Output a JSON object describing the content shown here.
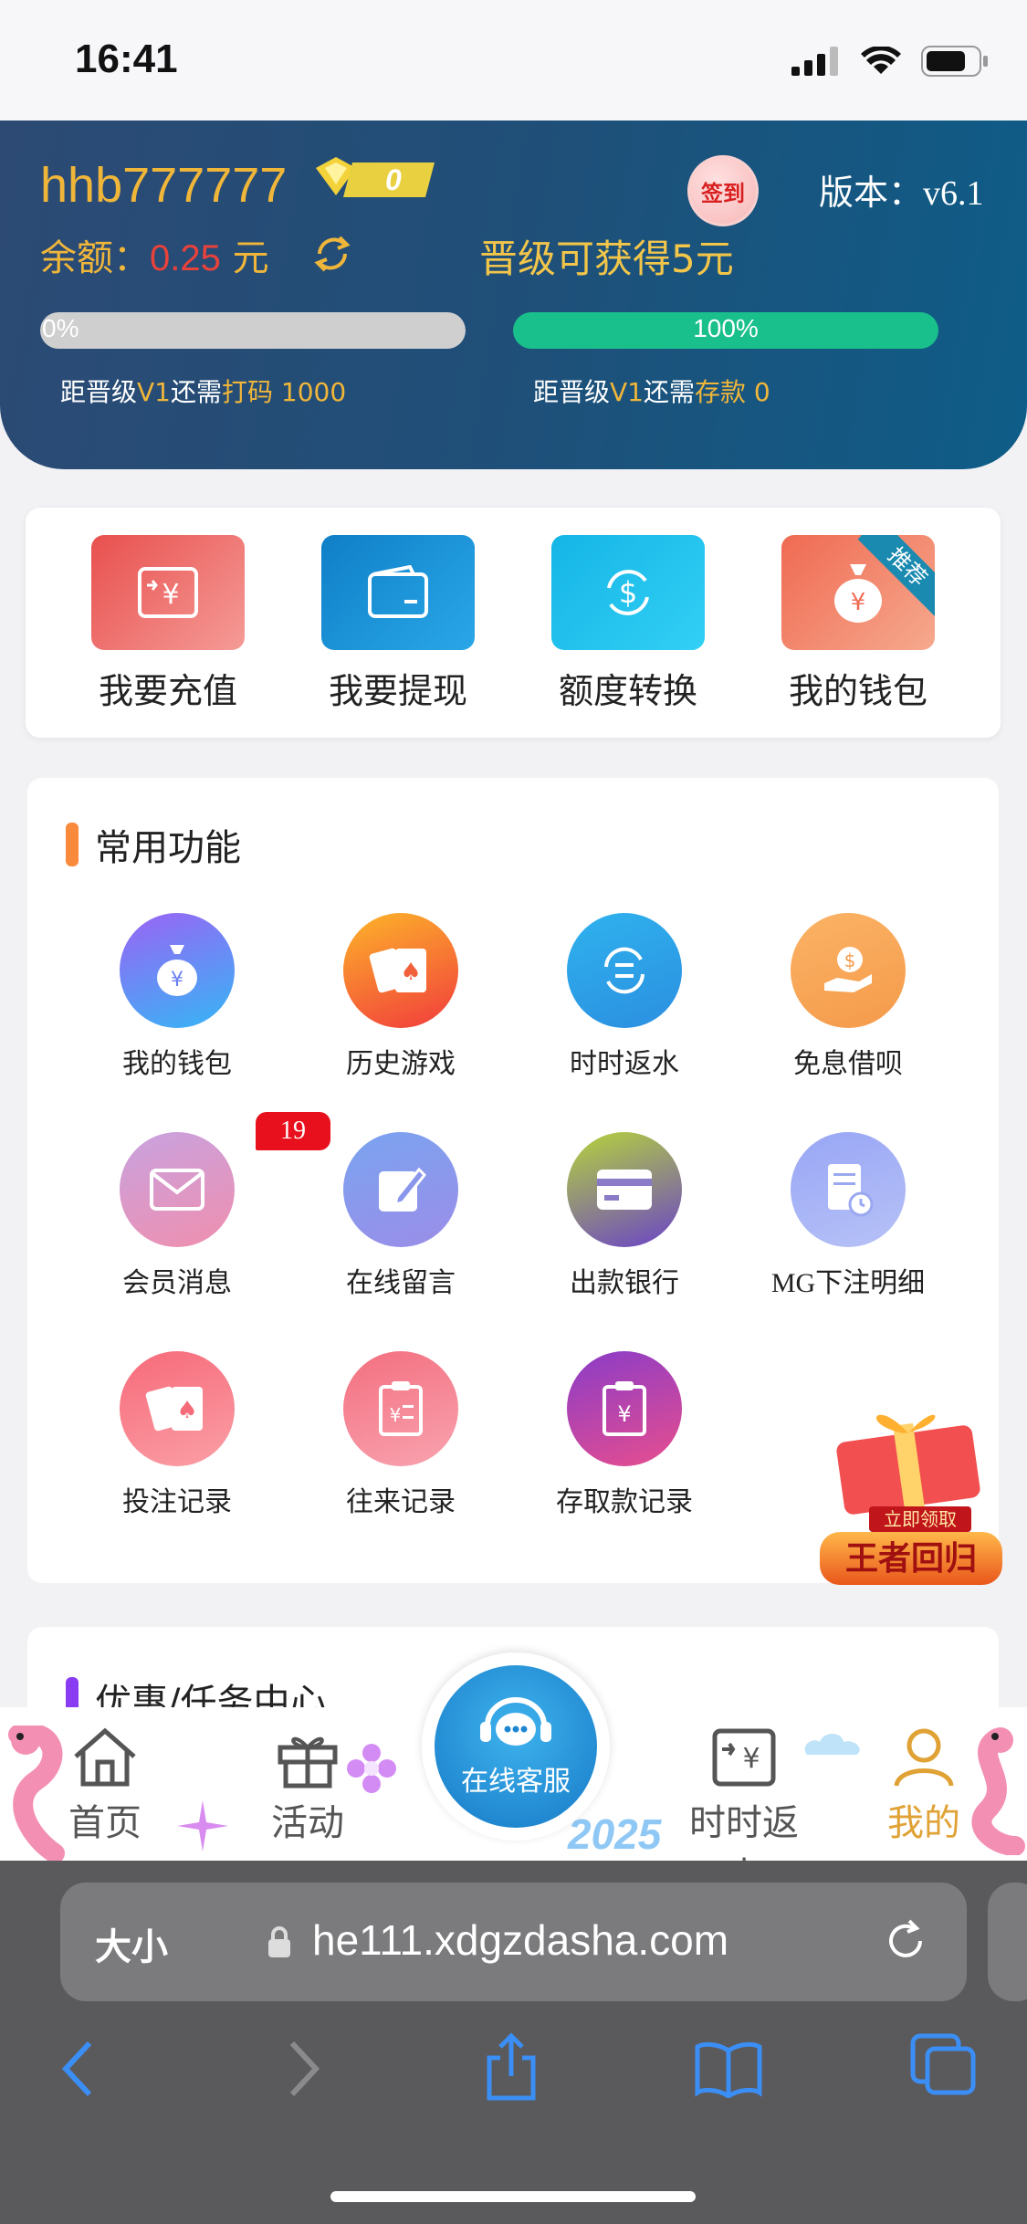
{
  "status_bar": {
    "time": "16:41"
  },
  "header": {
    "username": "hhb777777",
    "vip_level": "0",
    "checkin_label": "签到",
    "version": "版本：v6.1",
    "balance_label": "余额：",
    "balance_value": "0.25",
    "balance_unit": "元",
    "promo_text": "晋级可获得5元",
    "progress_left": {
      "percent_text": "0%",
      "fraction": 0,
      "prefix": "距晋级",
      "level": "V1",
      "mid": "还需",
      "requirement": "打码 1000"
    },
    "progress_right": {
      "percent_text": "100%",
      "fraction": 1,
      "prefix": "距晋级",
      "level": "V1",
      "mid": "还需",
      "requirement": "存款 0"
    }
  },
  "quick_actions": [
    {
      "label": "我要充值",
      "icon": "recharge-icon"
    },
    {
      "label": "我要提现",
      "icon": "wallet-card-icon"
    },
    {
      "label": "额度转换",
      "icon": "dollar-exchange-icon"
    },
    {
      "label": "我的钱包",
      "icon": "money-bag-icon",
      "ribbon": "推荐"
    }
  ],
  "common_functions": {
    "title": "常用功能",
    "items": [
      {
        "label": "我的钱包",
        "icon": "money-bag-icon"
      },
      {
        "label": "历史游戏",
        "icon": "playing-cards-icon"
      },
      {
        "label": "时时返水",
        "icon": "refresh-rebate-icon"
      },
      {
        "label": "免息借呗",
        "icon": "hand-coin-icon"
      },
      {
        "label": "会员消息",
        "icon": "envelope-icon",
        "badge": "19"
      },
      {
        "label": "在线留言",
        "icon": "edit-note-icon"
      },
      {
        "label": "出款银行",
        "icon": "bank-card-icon"
      },
      {
        "label": "MG下注明细",
        "icon": "bill-clock-icon"
      },
      {
        "label": "投注记录",
        "icon": "cards-icon"
      },
      {
        "label": "往来记录",
        "icon": "receipt-icon"
      },
      {
        "label": "存取款记录",
        "icon": "clipboard-yen-icon"
      }
    ]
  },
  "gift_float": {
    "claim": "立即领取",
    "title": "王者回归"
  },
  "promotions": {
    "title": "优惠/任务中心"
  },
  "tabbar": {
    "items": [
      {
        "label": "首页",
        "icon": "home-icon"
      },
      {
        "label": "活动",
        "icon": "gift-icon"
      },
      {
        "label": "在线客服",
        "icon": "chat-headset-icon"
      },
      {
        "label": "时时返水",
        "icon": "rebate-icon"
      },
      {
        "label": "我的",
        "icon": "user-icon"
      }
    ],
    "decor_text": "2025"
  },
  "browser": {
    "size_label": "大小",
    "url": "he111.xdgzdasha.com"
  },
  "colors": {
    "gold": "#f0b63a",
    "green": "#19c08b",
    "header": "#1f4f78",
    "active_tab": "#e0a235"
  }
}
